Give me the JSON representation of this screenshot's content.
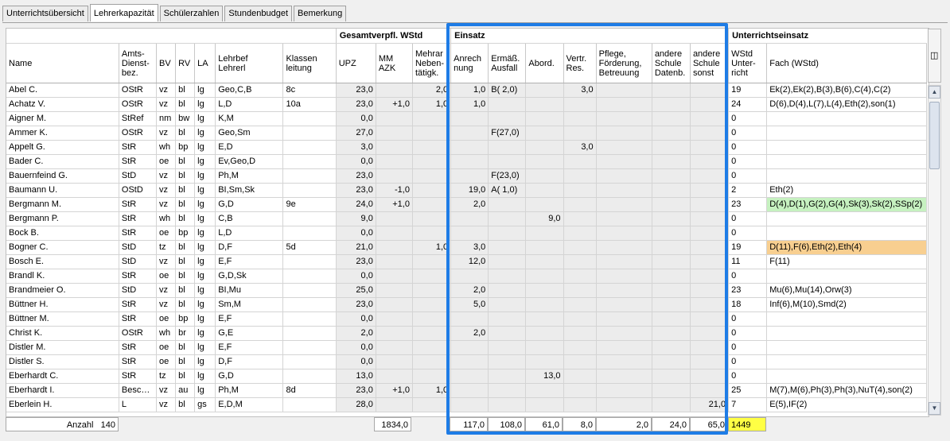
{
  "tabs": [
    {
      "label": "Unterrichtsübersicht",
      "active": false
    },
    {
      "label": "Lehrerkapazität",
      "active": true
    },
    {
      "label": "Schülerzahlen",
      "active": false
    },
    {
      "label": "Stundenbudget",
      "active": false
    },
    {
      "label": "Bemerkung",
      "active": false
    }
  ],
  "groups": {
    "gesamt": "Gesamtverpfl. WStd",
    "einsatz": "Einsatz",
    "unterricht": "Unterrichtseinsatz"
  },
  "columns": [
    "Name",
    "Amts-\nDienst-\nbez.",
    "BV",
    "RV",
    "LA",
    "Lehrbef\nLehrerl",
    "Klassen\nleitung",
    "UPZ",
    "MM\nAZK",
    "Mehrar\nNeben-\ntätigk.",
    "Anrech\nnung",
    "Ermäß.\nAusfall",
    "Abord.",
    "Vertr.\nRes.",
    "Pflege,\nFörderung,\nBetreuung",
    "andere\nSchule\nDatenb.",
    "andere\nSchule\nsonst",
    "WStd\nUnter-\nricht",
    "Fach (WStd)"
  ],
  "rows": [
    [
      "Abel C.",
      "OStR",
      "vz",
      "bl",
      "lg",
      "Geo,C,B",
      "8c",
      "23,0",
      "",
      "2,0",
      "1,0",
      "B( 2,0)",
      "",
      "3,0",
      "",
      "",
      "",
      "19",
      "Ek(2),Ek(2),B(3),B(6),C(4),C(2)"
    ],
    [
      "Achatz V.",
      "OStR",
      "vz",
      "bl",
      "lg",
      "L,D",
      "10a",
      "23,0",
      "+1,0",
      "1,0",
      "1,0",
      "",
      "",
      "",
      "",
      "",
      "",
      "24",
      "D(6),D(4),L(7),L(4),Eth(2),son(1)"
    ],
    [
      "Aigner M.",
      "StRef",
      "nm",
      "bw",
      "lg",
      "K,M",
      "",
      "0,0",
      "",
      "",
      "",
      "",
      "",
      "",
      "",
      "",
      "",
      "0",
      ""
    ],
    [
      "Ammer K.",
      "OStR",
      "vz",
      "bl",
      "lg",
      "Geo,Sm",
      "",
      "27,0",
      "",
      "",
      "",
      "F(27,0)",
      "",
      "",
      "",
      "",
      "",
      "0",
      ""
    ],
    [
      "Appelt G.",
      "StR",
      "wh",
      "bp",
      "lg",
      "E,D",
      "",
      "3,0",
      "",
      "",
      "",
      "",
      "",
      "3,0",
      "",
      "",
      "",
      "0",
      ""
    ],
    [
      "Bader C.",
      "StR",
      "oe",
      "bl",
      "lg",
      "Ev,Geo,D",
      "",
      "0,0",
      "",
      "",
      "",
      "",
      "",
      "",
      "",
      "",
      "",
      "0",
      ""
    ],
    [
      "Bauernfeind G.",
      "StD",
      "vz",
      "bl",
      "lg",
      "Ph,M",
      "",
      "23,0",
      "",
      "",
      "",
      "F(23,0)",
      "",
      "",
      "",
      "",
      "",
      "0",
      ""
    ],
    [
      "Baumann U.",
      "OStD",
      "vz",
      "bl",
      "lg",
      "BI,Sm,Sk",
      "",
      "23,0",
      "-1,0",
      "",
      "19,0",
      "A( 1,0)",
      "",
      "",
      "",
      "",
      "",
      "2",
      "Eth(2)"
    ],
    [
      "Bergmann M.",
      "StR",
      "vz",
      "bl",
      "lg",
      "G,D",
      "9e",
      "24,0",
      "+1,0",
      "",
      "2,0",
      "",
      "",
      "",
      "",
      "",
      "",
      "23",
      "D(4),D(1),G(2),G(4),Sk(3),Sk(2),SSp(2)"
    ],
    [
      "Bergmann P.",
      "StR",
      "wh",
      "bl",
      "lg",
      "C,B",
      "",
      "9,0",
      "",
      "",
      "",
      "",
      "9,0",
      "",
      "",
      "",
      "",
      "0",
      ""
    ],
    [
      "Bock B.",
      "StR",
      "oe",
      "bp",
      "lg",
      "L,D",
      "",
      "0,0",
      "",
      "",
      "",
      "",
      "",
      "",
      "",
      "",
      "",
      "0",
      ""
    ],
    [
      "Bogner C.",
      "StD",
      "tz",
      "bl",
      "lg",
      "D,F",
      "5d",
      "21,0",
      "",
      "1,0",
      "3,0",
      "",
      "",
      "",
      "",
      "",
      "",
      "19",
      "D(11),F(6),Eth(2),Eth(4)"
    ],
    [
      "Bosch E.",
      "StD",
      "vz",
      "bl",
      "lg",
      "E,F",
      "",
      "23,0",
      "",
      "",
      "12,0",
      "",
      "",
      "",
      "",
      "",
      "",
      "11",
      "F(11)"
    ],
    [
      "Brandl K.",
      "StR",
      "oe",
      "bl",
      "lg",
      "G,D,Sk",
      "",
      "0,0",
      "",
      "",
      "",
      "",
      "",
      "",
      "",
      "",
      "",
      "0",
      ""
    ],
    [
      "Brandmeier O.",
      "StD",
      "vz",
      "bl",
      "lg",
      "BI,Mu",
      "",
      "25,0",
      "",
      "",
      "2,0",
      "",
      "",
      "",
      "",
      "",
      "",
      "23",
      "Mu(6),Mu(14),Orw(3)"
    ],
    [
      "Büttner H.",
      "StR",
      "vz",
      "bl",
      "lg",
      "Sm,M",
      "",
      "23,0",
      "",
      "",
      "5,0",
      "",
      "",
      "",
      "",
      "",
      "",
      "18",
      "Inf(6),M(10),Smd(2)"
    ],
    [
      "Büttner M.",
      "StR",
      "oe",
      "bp",
      "lg",
      "E,F",
      "",
      "0,0",
      "",
      "",
      "",
      "",
      "",
      "",
      "",
      "",
      "",
      "0",
      ""
    ],
    [
      "Christ K.",
      "OStR",
      "wh",
      "br",
      "lg",
      "G,E",
      "",
      "2,0",
      "",
      "",
      "2,0",
      "",
      "",
      "",
      "",
      "",
      "",
      "0",
      ""
    ],
    [
      "Distler M.",
      "StR",
      "oe",
      "bl",
      "lg",
      "E,F",
      "",
      "0,0",
      "",
      "",
      "",
      "",
      "",
      "",
      "",
      "",
      "",
      "0",
      ""
    ],
    [
      "Distler S.",
      "StR",
      "oe",
      "bl",
      "lg",
      "D,F",
      "",
      "0,0",
      "",
      "",
      "",
      "",
      "",
      "",
      "",
      "",
      "",
      "0",
      ""
    ],
    [
      "Eberhardt C.",
      "StR",
      "tz",
      "bl",
      "lg",
      "G,D",
      "",
      "13,0",
      "",
      "",
      "",
      "",
      "13,0",
      "",
      "",
      "",
      "",
      "0",
      ""
    ],
    [
      "Eberhardt I.",
      "Besch…",
      "vz",
      "au",
      "lg",
      "Ph,M",
      "8d",
      "23,0",
      "+1,0",
      "1,0",
      "",
      "",
      "",
      "",
      "",
      "",
      "",
      "25",
      "M(7),M(6),Ph(3),Ph(3),NuT(4),son(2)"
    ],
    [
      "Eberlein H.",
      "L",
      "vz",
      "bl",
      "gs",
      "E,D,M",
      "",
      "28,0",
      "",
      "",
      "",
      "",
      "",
      "",
      "",
      "",
      "21,0",
      "7",
      "E(5),IF(2)"
    ]
  ],
  "fach_highlight": {
    "8": "green",
    "11": "orange"
  },
  "footer": {
    "anzahl_label": "Anzahl",
    "anzahl_value": "140",
    "upz_sum": "1834,0",
    "anrechnung_sum": "117,0",
    "ermaessigung_sum": "108,0",
    "abordnung_sum": "61,0",
    "vertretung_sum": "8,0",
    "pflege_sum": "2,0",
    "andere_datenb_sum": "24,0",
    "andere_sonst_sum": "65,0",
    "wstd_sum": "1449"
  },
  "colors": {
    "highlight": "#1e7ce6",
    "green": "#c6f1c0",
    "orange": "#f8cf90",
    "yellow": "#ffff44"
  },
  "icons": {
    "column_chooser": "column-chooser-icon",
    "scroll_up": "scroll-up-icon",
    "scroll_down": "scroll-down-icon"
  }
}
